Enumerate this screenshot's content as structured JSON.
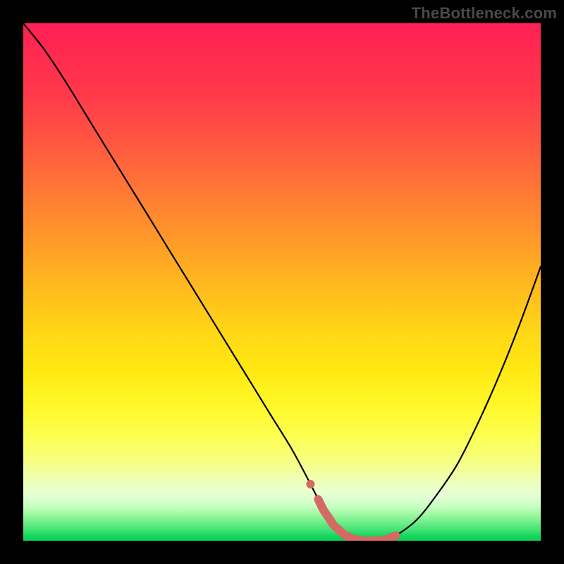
{
  "watermark": "TheBottleneck.com",
  "colors": {
    "curve": "#000000",
    "marker": "#d36a63",
    "gradient_top": "#ff1f55",
    "gradient_bottom": "#06d057"
  },
  "chart_data": {
    "type": "line",
    "title": "",
    "xlabel": "",
    "ylabel": "",
    "xlim": [
      0,
      100
    ],
    "ylim": [
      0,
      100
    ],
    "x": [
      0,
      4,
      8,
      12,
      16,
      20,
      24,
      28,
      32,
      36,
      40,
      44,
      48,
      52,
      56,
      58,
      60,
      62,
      64,
      66,
      68,
      70,
      72,
      76,
      80,
      84,
      88,
      92,
      96,
      100
    ],
    "values": [
      100,
      95,
      89,
      82.5,
      76,
      69.5,
      63,
      56.5,
      50,
      43.5,
      37,
      30.5,
      24,
      17.5,
      10,
      6,
      3,
      1.2,
      0.3,
      0,
      0,
      0.2,
      1,
      4,
      9,
      15,
      23,
      32,
      42,
      53
    ],
    "optimal_range_x": [
      57,
      72
    ],
    "annotations": []
  }
}
